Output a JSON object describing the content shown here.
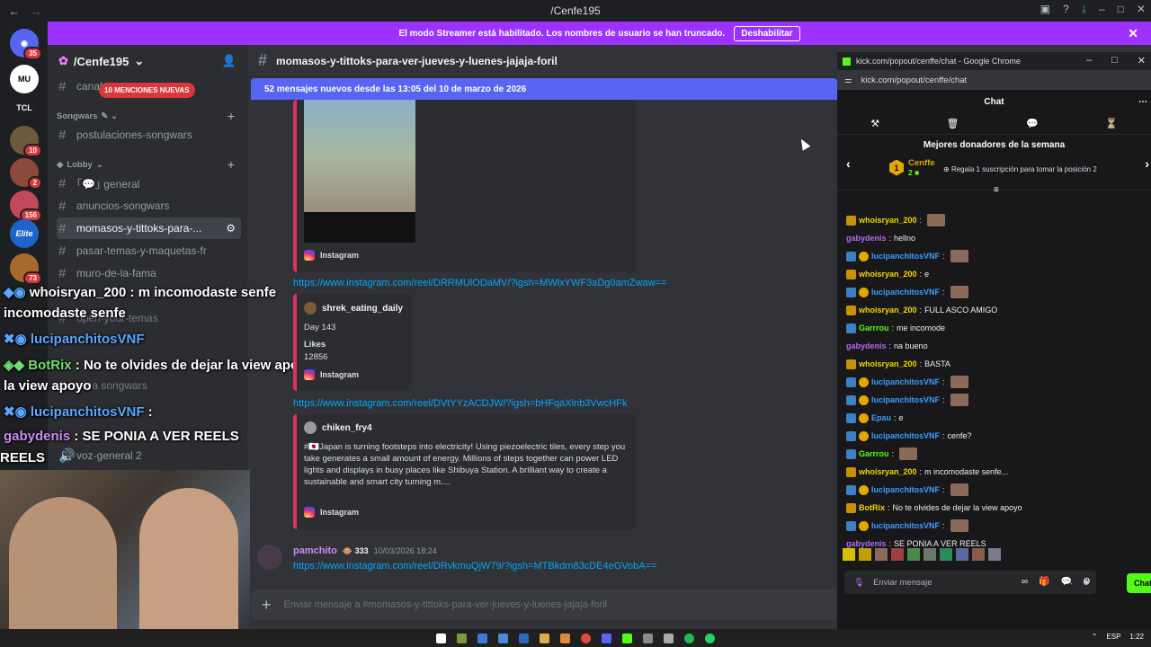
{
  "window": {
    "title": "/Cenfe195"
  },
  "banner": {
    "text": "El modo Streamer está habilitado. Los nombres de usuario se han truncado.",
    "button": "Deshabilitar"
  },
  "servers": [
    {
      "label": "",
      "badge": "35"
    },
    {
      "label": "MU",
      "badge": ""
    },
    {
      "label": "TCL",
      "badge": ""
    },
    {
      "label": "",
      "badge": "10"
    },
    {
      "label": "",
      "badge": "2"
    },
    {
      "label": "",
      "badge": "156"
    },
    {
      "label": "Elite",
      "badge": ""
    },
    {
      "label": "",
      "badge": "73"
    }
  ],
  "sidebar": {
    "server_name": "/Cenfe195",
    "mentions_badge": "10 MENCIONES NUEVAS",
    "top_channel": "canal",
    "categories": [
      {
        "name": "Songwars"
      },
      {
        "name": "Lobby"
      }
    ],
    "channels": [
      {
        "name": "postulaciones-songwars"
      },
      {
        "name": "｢💬｣ general"
      },
      {
        "name": "anuncios-songwars"
      },
      {
        "name": "momasos-y-tittoks-para-..."
      },
      {
        "name": "pasar-temas-y-maquetas-fr"
      },
      {
        "name": "muro-de-la-fama"
      },
      {
        "name": "open-your-temas"
      },
      {
        "name": "para songwars"
      }
    ],
    "voice_channel": "voz-general 2"
  },
  "overlay_chat": [
    {
      "user": "whoisryan_200",
      "text": "m incomodaste senfe"
    },
    {
      "user": "lucipanchitosVNF",
      "text": ""
    },
    {
      "user": "BotRix",
      "text": "No te olvides de dejar la view apoyo"
    },
    {
      "user": "lucipanchitosVNF",
      "text": ""
    },
    {
      "user": "gabydenis",
      "text": "SE PONIA A VER REELS"
    }
  ],
  "channel": {
    "name": "momasos-y-tittoks-para-ver-jueves-y-luenes-jajaja-foril",
    "new_messages": "52 mensajes nuevos desde las 13:05 del 10 de marzo de 2026",
    "input_placeholder": "Enviar mensaje a #momasos-y-tittoks-para-ver-jueves-y-luenes-jajaja-foril"
  },
  "messages": {
    "embed1_source": "Instagram",
    "link1": "https://www.instagram.com/reel/DRRMUlODaMV/?igsh=MWlxYWF3aDg0amZwaw==",
    "embed2": {
      "author": "shrek_eating_daily",
      "line1": "Day 143",
      "likes_label": "Likes",
      "likes_value": "12856",
      "source": "Instagram"
    },
    "link2": "https://www.instagram.com/reel/DVtYYzACDJW/?igsh=bHFqaXlnb3VwcHFk",
    "embed3": {
      "author": "chiken_fry4",
      "text": "#🇯🇵Japan is turning footsteps into electricity! Using piezoelectric tiles, every step you take generates a small amount of energy. Millions of steps together can power LED lights and displays in busy places like Shibuya Station. A brilliant way to create a sustainable and smart city turning m....",
      "source": "Instagram"
    },
    "last": {
      "author": "pamchito",
      "badge": "333",
      "timestamp": "10/03/2026 18:24",
      "link": "https://www.instagram.com/reel/DRvkmuQjW79/?igsh=MTBkdm83cDE4eGVobA=="
    }
  },
  "popout": {
    "window_title": "kick.com/popout/cenffe/chat - Google Chrome",
    "url": "kick.com/popout/cenffe/chat",
    "chat_title": "Chat",
    "donors_title": "Mejores donadores de la semana",
    "donor_rank": "1",
    "donor_name": "Cenffe",
    "donor_count": "2",
    "gift_text": "Regala 1 suscripción para tomar la posición 2",
    "input_placeholder": "Enviar mensaje",
    "send_label": "Chat",
    "messages": [
      {
        "user": "whoisryan_200",
        "text": "",
        "color": "yel"
      },
      {
        "user": "gabydenis",
        "text": "hellno",
        "color": "purp"
      },
      {
        "user": "lucipanchitosVNF",
        "text": "",
        "color": "blue"
      },
      {
        "user": "whoisryan_200",
        "text": "e",
        "color": "yel"
      },
      {
        "user": "lucipanchitosVNF",
        "text": "",
        "color": "blue"
      },
      {
        "user": "whoisryan_200",
        "text": "FULL ASCO AMIGO",
        "color": "yel"
      },
      {
        "user": "Garrrou",
        "text": "me incomode",
        "color": "grn"
      },
      {
        "user": "gabydenis",
        "text": "na bueno",
        "color": "purp"
      },
      {
        "user": "whoisryan_200",
        "text": "BASTA",
        "color": "yel"
      },
      {
        "user": "lucipanchitosVNF",
        "text": "",
        "color": "blue"
      },
      {
        "user": "lucipanchitosVNF",
        "text": "",
        "color": "blue"
      },
      {
        "user": "Epau",
        "text": "e",
        "color": "blue"
      },
      {
        "user": "lucipanchitosVNF",
        "text": "cenfe?",
        "color": "blue"
      },
      {
        "user": "Garrrou",
        "text": "",
        "color": "grn"
      },
      {
        "user": "whoisryan_200",
        "text": "m incomodaste senfe...",
        "color": "yel"
      },
      {
        "user": "lucipanchitosVNF",
        "text": "",
        "color": "blue"
      },
      {
        "user": "BotRix",
        "text": "No te olvides de dejar la view apoyo",
        "color": "yel"
      },
      {
        "user": "lucipanchitosVNF",
        "text": "",
        "color": "blue"
      },
      {
        "user": "gabydenis",
        "text": "SE PONIA A VER REELS",
        "color": "purp"
      }
    ]
  },
  "taskbar": {
    "lang": "ESP",
    "time": "1:22"
  }
}
